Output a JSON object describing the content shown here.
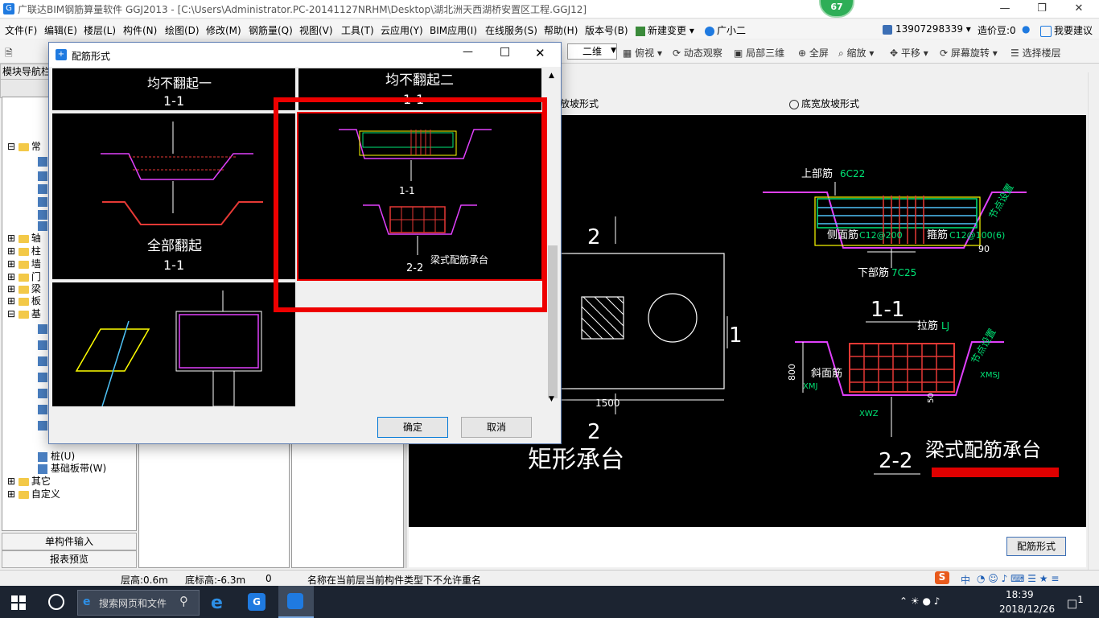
{
  "window": {
    "title": "广联达BIM钢筋算量软件 GGJ2013 - [C:\\Users\\Administrator.PC-20141127NRHM\\Desktop\\湖北洲天西湖桥安置区工程.GGJ12]",
    "badge": "67"
  },
  "menu": [
    "文件(F)",
    "编辑(E)",
    "楼层(L)",
    "构件(N)",
    "绘图(D)",
    "修改(M)",
    "钢筋量(Q)",
    "视图(V)",
    "工具(T)",
    "云应用(Y)",
    "BIM应用(I)",
    "在线服务(S)",
    "帮助(H)",
    "版本号(B)",
    "新建变更",
    "广小二"
  ],
  "account": {
    "phone": "13907298339",
    "beans": "造价豆:0",
    "suggest": "我要建议"
  },
  "toolbar": {
    "view_mode": "二维",
    "items": [
      "俯视",
      "动态观察",
      "局部三维",
      "全屏",
      "缩放",
      "平移",
      "屏幕旋转",
      "选择楼层"
    ]
  },
  "nav": {
    "title": "模块导航栏",
    "tree": [
      "常",
      "轴",
      "柱",
      "墙",
      "门",
      "梁",
      "板",
      "基",
      "桩(U)",
      "基础板带(W)",
      "其它",
      "自定义"
    ],
    "btn_single": "单构件输入",
    "btn_report": "报表预览"
  },
  "right": {
    "radio1": "放坡形式",
    "radio2": "底宽放坡形式",
    "btn": "配筋形式"
  },
  "cad": {
    "main_title": "矩形承台",
    "dim_1500": "1500",
    "sec2": "2",
    "sec1": "1",
    "top_bar": "上部筋",
    "top_val": "6C22",
    "side_bar": "侧面筋",
    "side_val": "C12@200",
    "stirrup": "箍筋",
    "stirrup_val": "C12@100(6)",
    "node": "节点设置",
    "bottom_bar": "下部筋",
    "bottom_val": "7C25",
    "label_11": "1-1",
    "pull_bar": "拉筋",
    "pull_val": "LJ",
    "slope_bar": "斜面筋",
    "slope_val": "XMJ",
    "xmsj": "XMSJ",
    "xwz": "XWZ",
    "h800": "800",
    "h50": "50",
    "angle": "90",
    "label_22": "2-2",
    "beam_title": "梁式配筋承台"
  },
  "dialog": {
    "title": "配筋形式",
    "t1": "均不翻起一",
    "t1_sec": "1-1",
    "t2": "均不翻起二",
    "t2_sec": "1-1",
    "t3": "全部翻起",
    "t3_sec": "1-1",
    "t4_sec1": "1-1",
    "t4_sec2": "2-2",
    "t4": "梁式配筋承台",
    "ok": "确定",
    "cancel": "取消"
  },
  "status": {
    "floor_height": "层高:0.6m",
    "base_height": "底标高:-6.3m",
    "zero": "0",
    "message": "名称在当前层当前构件类型下不允许重名"
  },
  "taskbar": {
    "search": "搜索网页和文件",
    "time": "18:39",
    "date": "2018/12/26",
    "notif": "1",
    "ime": "中"
  },
  "colors": {
    "highlight": "#e00000",
    "cad_bg": "#000000",
    "accent": "#1f7ae0"
  }
}
